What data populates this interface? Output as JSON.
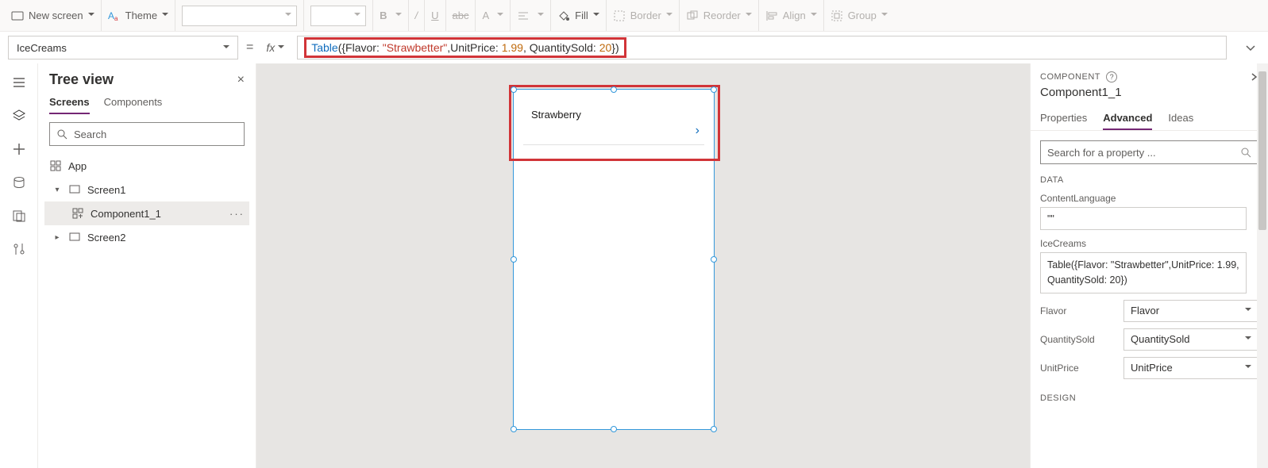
{
  "toolbar": {
    "new_screen": "New screen",
    "theme": "Theme",
    "fill": "Fill",
    "border": "Border",
    "reorder": "Reorder",
    "align": "Align",
    "group": "Group"
  },
  "formula": {
    "property": "IceCreams",
    "tokens": {
      "func": "Table",
      "open": "({Flavor: ",
      "str": "\"Strawbetter\"",
      "mid1": ",UnitPrice: ",
      "num1": "1.99",
      "mid2": ", QuantitySold: ",
      "num2": "20",
      "close": "})"
    }
  },
  "tree": {
    "title": "Tree view",
    "tabs": {
      "screens": "Screens",
      "components": "Components"
    },
    "search_placeholder": "Search",
    "items": {
      "app": "App",
      "screen1": "Screen1",
      "component": "Component1_1",
      "screen2": "Screen2"
    }
  },
  "canvas": {
    "gallery_item": "Strawberry"
  },
  "panel": {
    "header": "COMPONENT",
    "name": "Component1_1",
    "tabs": {
      "properties": "Properties",
      "advanced": "Advanced",
      "ideas": "Ideas"
    },
    "search_placeholder": "Search for a property ...",
    "section_data": "DATA",
    "content_language_label": "ContentLanguage",
    "content_language_value": "\"\"",
    "icecreams_label": "IceCreams",
    "icecreams_value": "Table({Flavor: \"Strawbetter\",UnitPrice: 1.99, QuantitySold: 20})",
    "fields": {
      "flavor_label": "Flavor",
      "flavor_value": "Flavor",
      "qty_label": "QuantitySold",
      "qty_value": "QuantitySold",
      "price_label": "UnitPrice",
      "price_value": "UnitPrice"
    },
    "section_design": "DESIGN"
  }
}
